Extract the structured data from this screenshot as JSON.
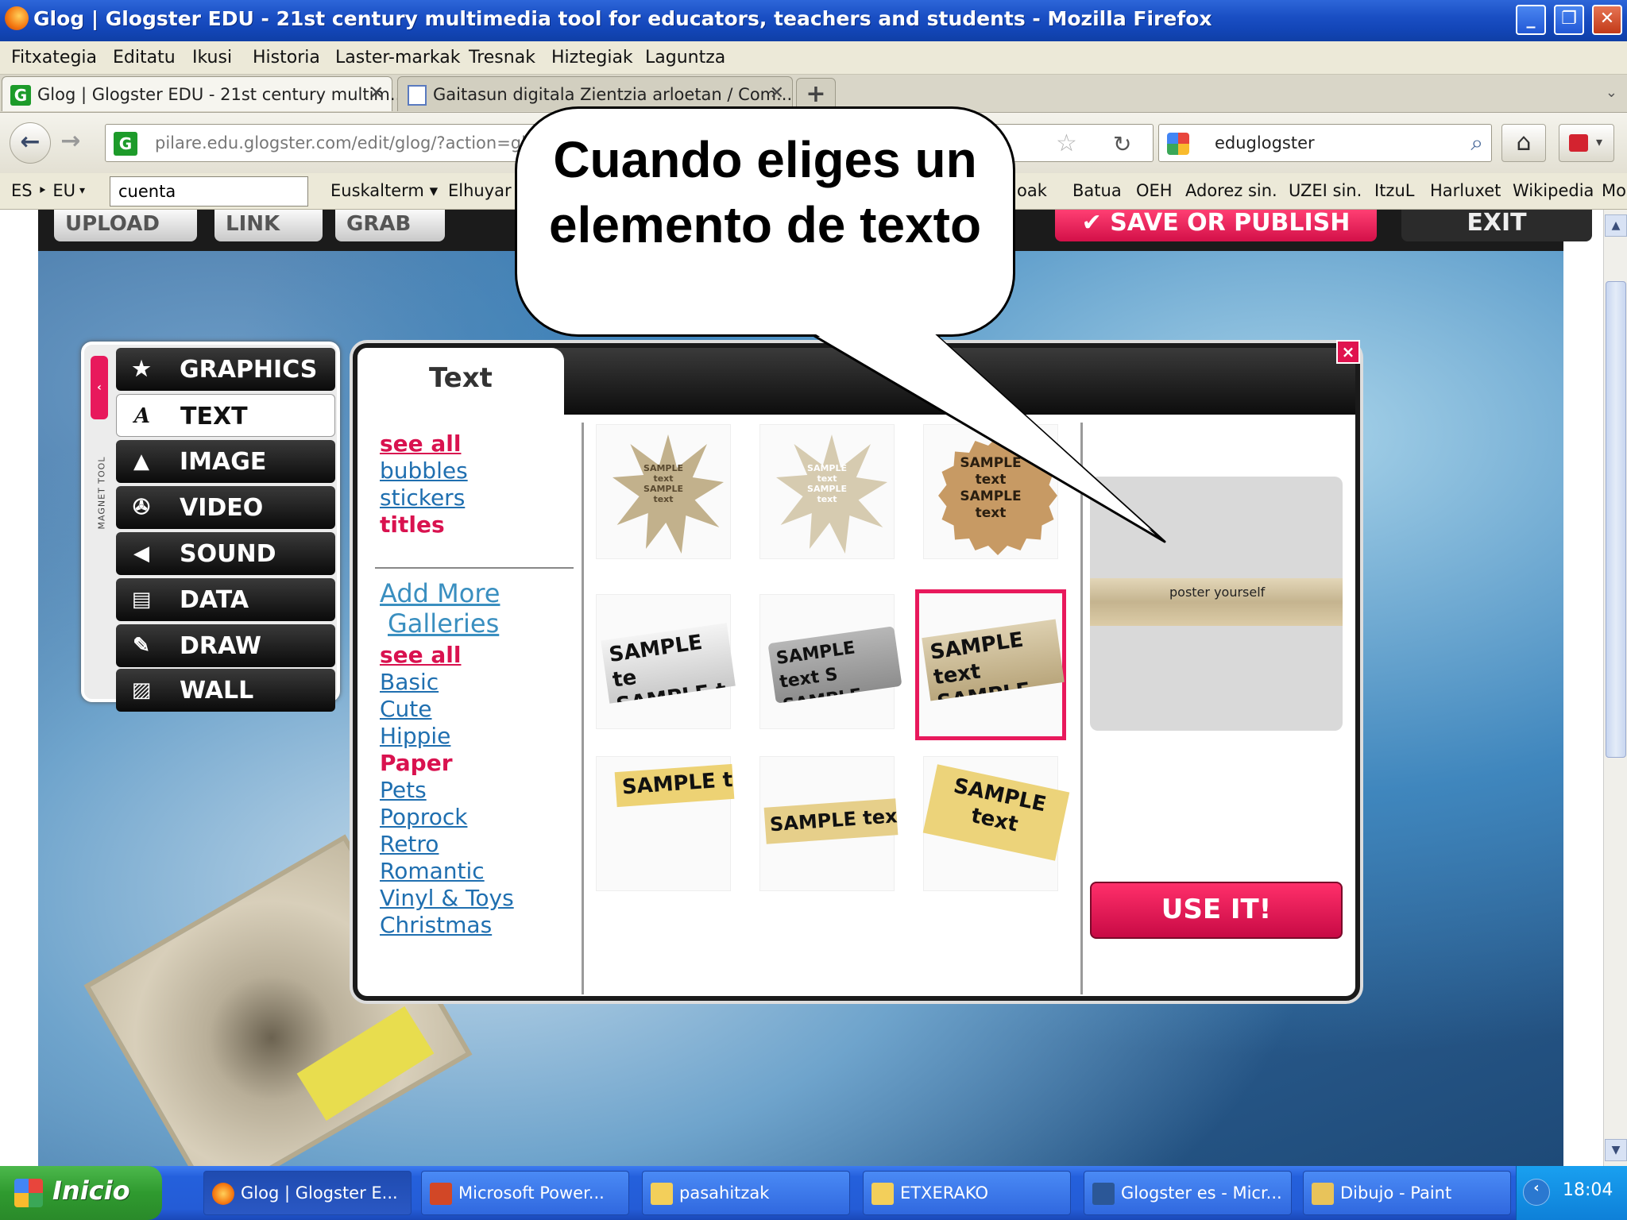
{
  "window": {
    "title": "Glog | Glogster EDU - 21st century multimedia tool for educators, teachers and students - Mozilla Firefox",
    "minimize": "_",
    "restore": "❐",
    "close": "✕"
  },
  "menu": [
    "Fitxategia",
    "Editatu",
    "Ikusi",
    "Historia",
    "Laster-markak",
    "Tresnak",
    "Hiztegiak",
    "Laguntza"
  ],
  "tabs": [
    {
      "label": "Glog | Glogster EDU - 21st century multim...",
      "close": "✕",
      "icon": "G"
    },
    {
      "label": "Gaitasun digitala Zientzia arloetan / Com...",
      "close": "✕"
    }
  ],
  "new_tab": "+",
  "tab_list": "⌄",
  "nav": {
    "back": "←",
    "forward": "→",
    "url": "pilare.edu.glogster.com/edit/glog/?action=glogs",
    "site_icon": "G",
    "star": "☆",
    "reload": "↻",
    "search_value": "eduglogster",
    "search_icon": "⌕",
    "home": "⌂",
    "addon_arrow": "▾"
  },
  "bookmarks": {
    "lang": "ES ‣ EU",
    "lang_arrow": "▾",
    "dict_input": "cuenta",
    "items": [
      "Euskalterm ▾",
      "Elhuyar",
      "oak",
      "Batua",
      "OEH",
      "Adorez sin.",
      "UZEI sin.",
      "ItzuL",
      "Harluxet",
      "Wikipedia",
      "Mo"
    ]
  },
  "glogster_toolbar": {
    "upload": "UPLOAD",
    "link": "LINK",
    "grab": "GRAB",
    "save": "✔ SAVE OR PUBLISH",
    "exit": "EXIT"
  },
  "magnet_tool": {
    "vertical_label": "MAGNET TOOL",
    "handle": "‹",
    "items": [
      {
        "label": "GRAPHICS",
        "icon": "★"
      },
      {
        "label": "TEXT",
        "icon": "A"
      },
      {
        "label": "IMAGE",
        "icon": "▲"
      },
      {
        "label": "VIDEO",
        "icon": "✇"
      },
      {
        "label": "SOUND",
        "icon": "◀"
      },
      {
        "label": "DATA",
        "icon": "▤"
      },
      {
        "label": "DRAW",
        "icon": "✎"
      },
      {
        "label": "WALL",
        "icon": "▨"
      }
    ],
    "active": "TEXT"
  },
  "text_dialog": {
    "tab_title": "Text",
    "close": "×",
    "type_links": [
      "see all",
      "bubbles",
      "stickers",
      "titles"
    ],
    "add_more": "Add More",
    "galleries": "Galleries",
    "gallery_links": [
      "see all",
      "Basic",
      "Cute",
      "Hippie",
      "Paper",
      "Pets",
      "Poprock",
      "Retro",
      "Romantic",
      "Vinyl & Toys",
      "Christmas"
    ],
    "thumb_sample_small": "SAMPLE\ntext\nSAMPLE\ntext",
    "thumb_rows": [
      [
        "SAMPLE text SAMPLE text",
        "SAMPLE text SAMPLE text",
        "SAMPLE text SAMPLE text"
      ],
      [
        "SAMPLE te SAMPLE t",
        "SAMPLE text S SAMPLE text",
        "SAMPLE text SAMPLE tex"
      ],
      [
        "SAMPLE text",
        "SAMPLE text",
        "SAMPLE text"
      ]
    ],
    "preview_text": "poster yourself",
    "use_it": "USE IT!"
  },
  "callout": {
    "text": "Cuando eliges un elemento de texto"
  },
  "scrollbar": {
    "up": "▲",
    "down": "▼"
  },
  "taskbar": {
    "start": "Inicio",
    "tasks": [
      {
        "label": "Glog | Glogster E..."
      },
      {
        "label": "Microsoft Power..."
      },
      {
        "label": "pasahitzak"
      },
      {
        "label": "ETXERAKO"
      },
      {
        "label": "Glogster es - Micr..."
      },
      {
        "label": "Dibujo - Paint"
      }
    ],
    "tray_arrow": "‹",
    "clock": "18:04"
  },
  "colors": {
    "accent_pink": "#e8195c",
    "link_blue": "#1f6fb0",
    "xp_blue": "#2460dc"
  }
}
